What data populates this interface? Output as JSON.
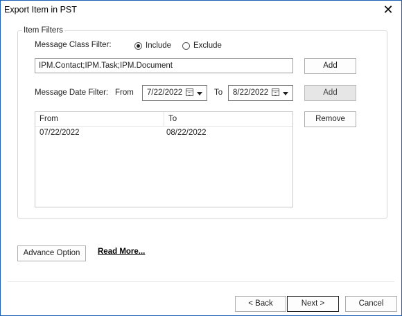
{
  "window": {
    "title": "Export Item in PST",
    "close_glyph": "✕"
  },
  "group": {
    "legend": "Item Filters"
  },
  "class_filter": {
    "label": "Message Class Filter:",
    "include_label": "Include",
    "exclude_label": "Exclude",
    "selected": "include",
    "value": "IPM.Contact;IPM.Task;IPM.Document",
    "add_label": "Add"
  },
  "date_filter": {
    "label": "Message Date Filter:",
    "from_label": "From",
    "from_value": "7/22/2022",
    "to_label": "To",
    "to_value": "8/22/2022",
    "add_label": "Add",
    "remove_label": "Remove"
  },
  "date_list": {
    "columns": [
      "From",
      "To"
    ],
    "rows": [
      {
        "from": "07/22/2022",
        "to": "08/22/2022"
      }
    ]
  },
  "advance_option_label": "Advance Option",
  "read_more_label": "Read More...",
  "footer": {
    "back_label": "< Back",
    "next_label": "Next >",
    "cancel_label": "Cancel"
  }
}
